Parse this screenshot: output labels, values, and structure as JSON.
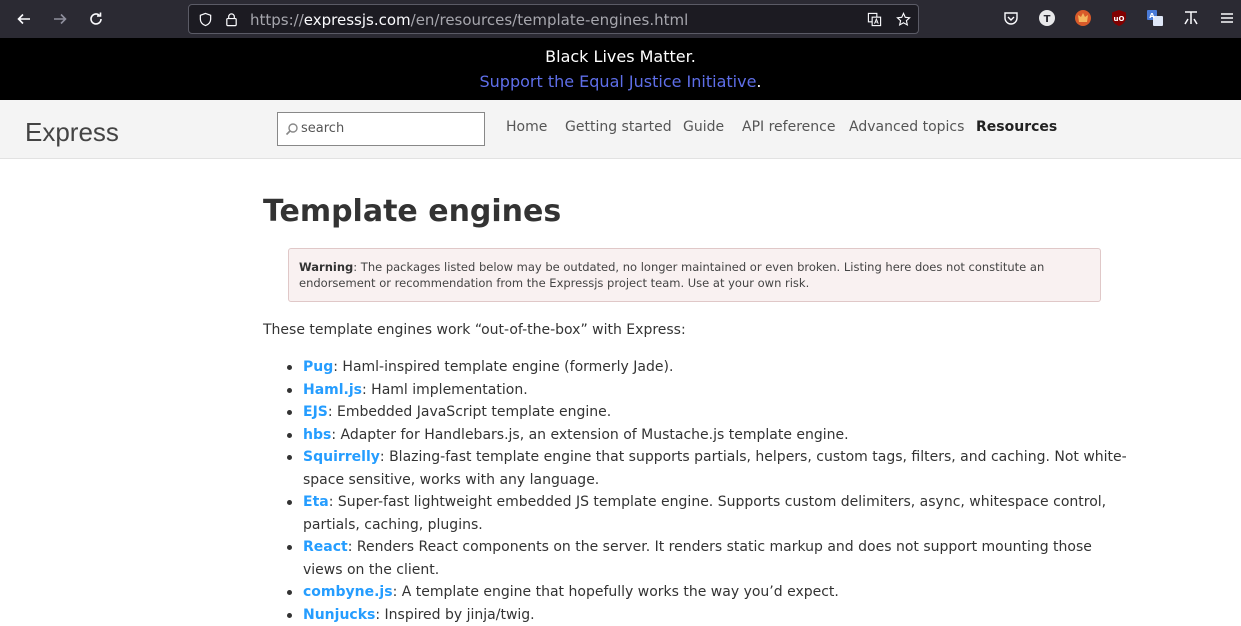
{
  "browser": {
    "url_base": "https://",
    "url_host": "expressjs.com",
    "url_path": "/en/resources/template-engines.html"
  },
  "banner": {
    "line1": "Black Lives Matter.",
    "link": "Support the Equal Justice Initiative",
    "suffix": "."
  },
  "header": {
    "logo": "Express",
    "search_placeholder": "search",
    "nav": [
      "Home",
      "Getting started",
      "Guide",
      "API reference",
      "Advanced topics",
      "Resources"
    ]
  },
  "page": {
    "title": "Template engines",
    "warning_label": "Warning",
    "warning_text": ": The packages listed below may be outdated, no longer maintained or even broken. Listing here does not constitute an endorsement or recommendation from the Expressjs project team. Use at your own risk.",
    "intro": "These template engines work “out-of-the-box” with Express:",
    "engines": [
      {
        "name": "Pug",
        "desc": ": Haml-inspired template engine (formerly Jade)."
      },
      {
        "name": "Haml.js",
        "desc": ": Haml implementation."
      },
      {
        "name": "EJS",
        "desc": ": Embedded JavaScript template engine."
      },
      {
        "name": "hbs",
        "desc": ": Adapter for Handlebars.js, an extension of Mustache.js template engine."
      },
      {
        "name": "Squirrelly",
        "desc": ": Blazing-fast template engine that supports partials, helpers, custom tags, filters, and caching. Not white-space sensitive, works with any language."
      },
      {
        "name": "Eta",
        "desc": ": Super-fast lightweight embedded JS template engine. Supports custom delimiters, async, whitespace control, partials, caching, plugins."
      },
      {
        "name": "React",
        "desc": ": Renders React components on the server. It renders static markup and does not support mounting those views on the client."
      },
      {
        "name": "combyne.js",
        "desc": ": A template engine that hopefully works the way you’d expect."
      },
      {
        "name": "Nunjucks",
        "desc": ": Inspired by jinja/twig."
      }
    ]
  },
  "colors": {
    "browser_bg": "#2b2a33",
    "banner_bg": "#000000",
    "banner_link": "#5e6ee8",
    "link": "#259dff",
    "warning_bg": "#f9f1f1"
  }
}
